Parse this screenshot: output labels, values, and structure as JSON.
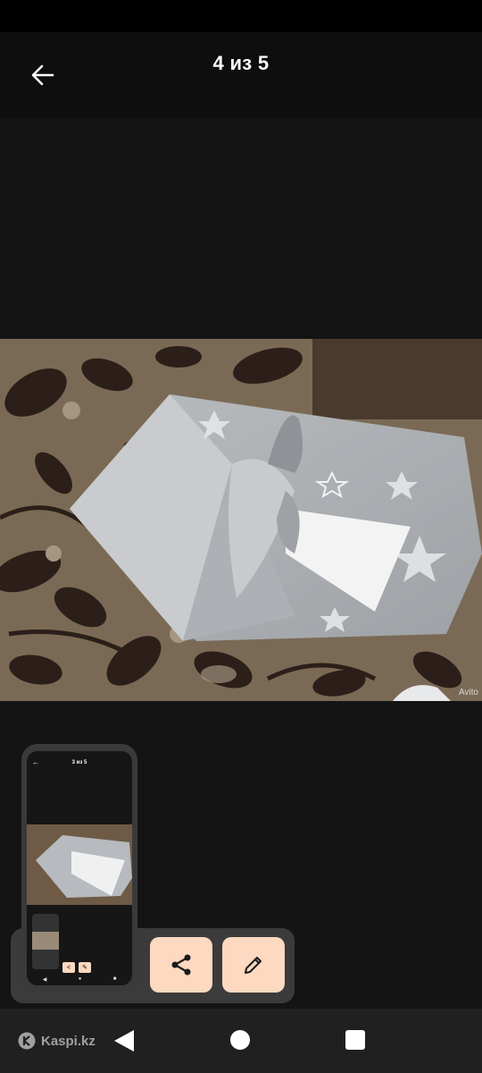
{
  "header": {
    "title": "4 из 5",
    "back_icon": "arrow-left-icon"
  },
  "photo": {
    "watermark": "Avito",
    "description_icon": "swaddle-photo"
  },
  "screenshot_preview": {
    "mini_title": "3 из 5",
    "share_icon": "share-icon",
    "edit_icon": "pencil-icon"
  },
  "nav": {
    "brand": "Kaspi.kz"
  },
  "colors": {
    "accent": "#fcd9c0",
    "background": "#121212",
    "topbar": "#0e0e0e"
  }
}
